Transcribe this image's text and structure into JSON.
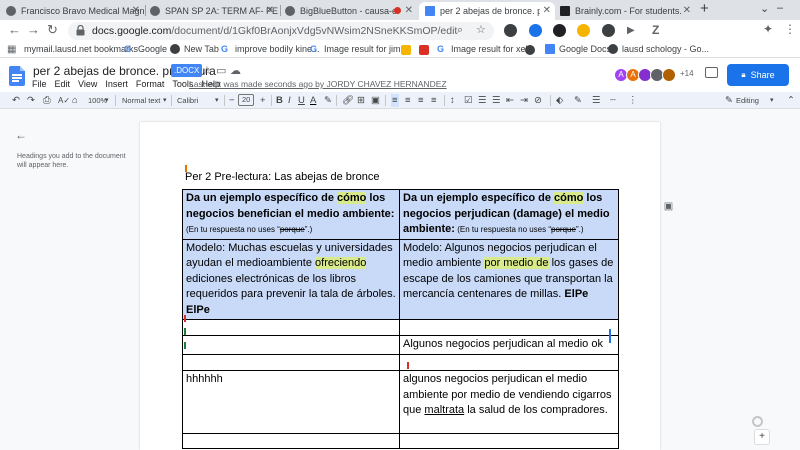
{
  "browser": {
    "tabs": [
      {
        "title": "Francisco Bravo Medical Magn",
        "color": "#5f6368",
        "active": false
      },
      {
        "title": "SPAN SP 2A: TERM AF- PERIOD",
        "color": "#5f6368",
        "active": false
      },
      {
        "title": "BigBlueButton - causa-efect",
        "color": "#5f6368",
        "active": false
      },
      {
        "title": "per 2 abejas de bronce. prelectu",
        "color": "#4285f4",
        "active": true
      },
      {
        "title": "Brainly.com - For students. By s",
        "color": "#202124",
        "active": false
      }
    ],
    "new_tab_label": "+",
    "url_host": "docs.google.com",
    "url_path": "/document/d/1Gkf0BrAonjxVdg5vNWsim2NSneKKSmOP/edit",
    "bookmarks": [
      {
        "label": "mymail.lausd.net bookmarks",
        "color": "#5f6368"
      },
      {
        "label": "Google",
        "color": "#4285f4"
      },
      {
        "label": "New Tab",
        "color": "#5f6368"
      },
      {
        "label": "improve bodily kine...",
        "color": "#4285f4"
      },
      {
        "label": "Image result for jim...",
        "color": "#4285f4"
      },
      {
        "label": "Image result for xello",
        "color": "#4285f4"
      },
      {
        "label": "Google Docs",
        "color": "#4285f4"
      },
      {
        "label": "lausd schology - Go...",
        "color": "#4285f4"
      }
    ]
  },
  "docs": {
    "title": "per 2 abejas de bronce. prelectura",
    "badge": ".DOCX",
    "menu": [
      "File",
      "Edit",
      "View",
      "Insert",
      "Format",
      "Tools",
      "Help"
    ],
    "last_edit": "Last edit was made seconds ago by JORDY CHAVEZ HERNANDEZ",
    "collaborators_extra": "+14",
    "share_label": "Share",
    "toolbar": {
      "zoom": "100%",
      "style": "Normal text",
      "font": "Calibri",
      "font_size": "20",
      "mode": "Editing"
    },
    "outline_hint": "Headings you add to the document will appear here.",
    "accent": "#1a73e8",
    "table_header_bg": "#c9daf8",
    "highlight": "#d9ea8a"
  },
  "document": {
    "heading": "Per 2  Pre-lectura: Las abejas de bronce",
    "col1_header_a": "Da un ejemplo específico de ",
    "col1_header_hl": "cómo",
    "col1_header_b": " los negocios benefician el medio ambiente:",
    "col1_header_note_a": "(En tu respuesta no uses “",
    "col1_header_note_strike": "porque",
    "col1_header_note_b": "”.)",
    "col2_header_a": "Da un ejemplo específico de ",
    "col2_header_hl": "cómo",
    "col2_header_b": " los negocios perjudican (damage) el medio ambiente:",
    "col2_header_note_a": " (En tu respuesta no uses “",
    "col2_header_note_strike": "porque",
    "col2_header_note_b": "”.)",
    "model1_a": "Modelo: Muchas escuelas y universidades ayudan el medioambiente ",
    "model1_hl": "ofreciendo",
    "model1_b": " ediciones electrónicas de los libros requeridos para prevenir la tala de árboles. ",
    "model1_bold": "ElPe",
    "model2_a": "Modelo:  Algunos negocios perjudican el medio ambiente ",
    "model2_hl": "por medio de",
    "model2_b": " los gases de escape de los camiones que transportan la mercancía centenares de millas.  ",
    "model2_bold": "ElPe",
    "row3_col2": "Algunos negocios perjudican al medio ok",
    "row5_col1": "hhhhhh",
    "row5_col2_a": "algunos negocios perjudican el medio ambiente por medio de vendiendo cigarros que ",
    "row5_col2_ul": "maltrata",
    "row5_col2_b": " la salud de los compradores."
  }
}
